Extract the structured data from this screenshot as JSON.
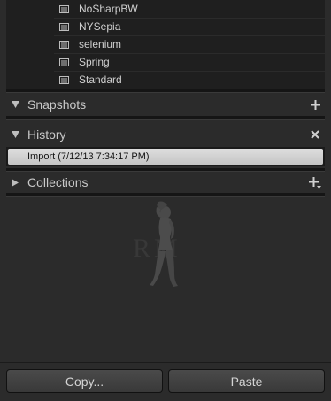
{
  "presets": [
    {
      "label": "NoSharpBW",
      "icon": "preset-icon"
    },
    {
      "label": "NYSepia",
      "icon": "preset-icon"
    },
    {
      "label": "selenium",
      "icon": "preset-icon"
    },
    {
      "label": "Spring",
      "icon": "preset-icon"
    },
    {
      "label": "Standard",
      "icon": "preset-icon"
    }
  ],
  "panels": {
    "snapshots": {
      "title": "Snapshots",
      "toggle_icon": "triangle-down-icon",
      "action_icon": "plus-icon"
    },
    "history": {
      "title": "History",
      "toggle_icon": "triangle-down-icon",
      "action_icon": "close-icon"
    },
    "collections": {
      "title": "Collections",
      "toggle_icon": "triangle-right-icon",
      "action_icon": "plus-dropdown-icon"
    }
  },
  "history_items": [
    {
      "label": "Import (7/12/13 7:34:17 PM)",
      "selected": true
    }
  ],
  "logo": {
    "text": "RM"
  },
  "buttons": {
    "copy_label": "Copy...",
    "paste_label": "Paste"
  },
  "colors": {
    "panel_bg": "#2b2b2b",
    "list_bg": "#1f1f1f",
    "selected_row": "#d0d0d0"
  }
}
